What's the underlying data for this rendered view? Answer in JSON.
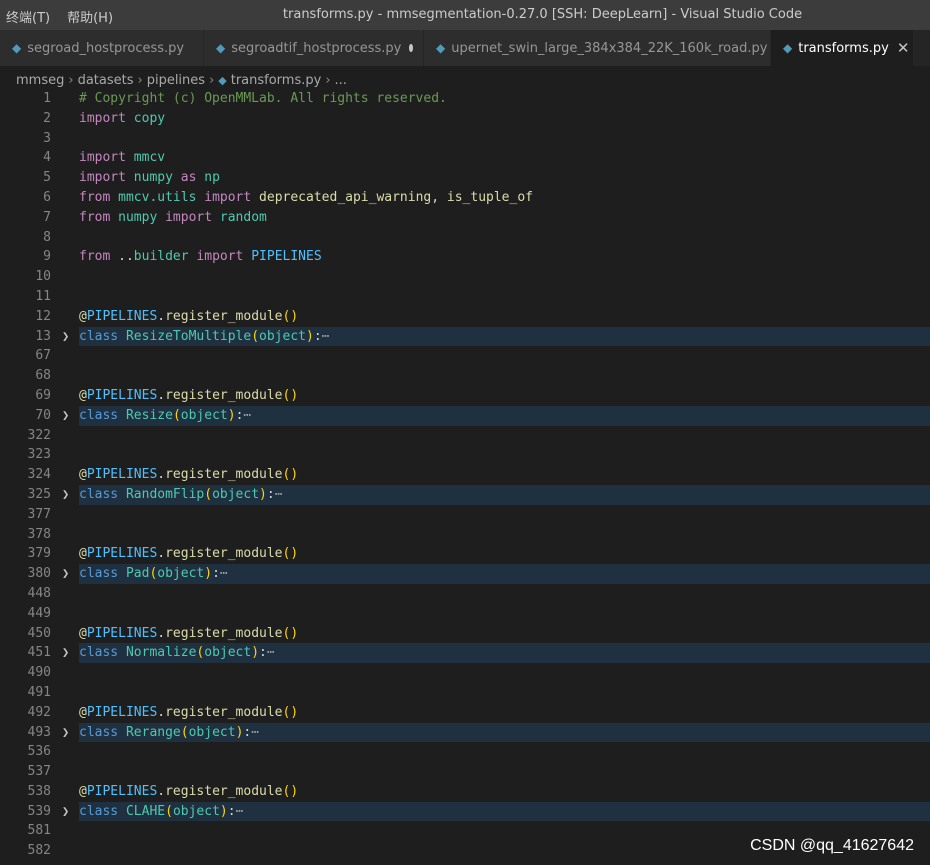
{
  "titlebar": {
    "menu": [
      "终端(T)",
      "帮助(H)"
    ],
    "title": "transforms.py - mmsegmentation-0.27.0 [SSH: DeepLearn] - Visual Studio Code"
  },
  "tabs": [
    {
      "label": "segroad_hostprocess.py",
      "state": "none"
    },
    {
      "label": "segroadtif_hostprocess.py",
      "state": "modified"
    },
    {
      "label": "upernet_swin_large_384x384_22K_160k_road.py",
      "state": "modified"
    },
    {
      "label": "transforms.py",
      "state": "close",
      "active": true
    }
  ],
  "breadcrumb": [
    "mmseg",
    "datasets",
    "pipelines",
    "transforms.py",
    "..."
  ],
  "lines": [
    {
      "n": "1",
      "tokens": [
        [
          "# Copyright (c) OpenMMLab. All rights reserved.",
          "comment"
        ]
      ]
    },
    {
      "n": "2",
      "tokens": [
        [
          "import",
          "kw"
        ],
        [
          " ",
          ""
        ],
        [
          "copy",
          "mod"
        ]
      ]
    },
    {
      "n": "3",
      "tokens": []
    },
    {
      "n": "4",
      "tokens": [
        [
          "import",
          "kw"
        ],
        [
          " ",
          ""
        ],
        [
          "mmcv",
          "mod"
        ]
      ]
    },
    {
      "n": "5",
      "tokens": [
        [
          "import",
          "kw"
        ],
        [
          " ",
          ""
        ],
        [
          "numpy",
          "mod"
        ],
        [
          " ",
          ""
        ],
        [
          "as",
          "kw"
        ],
        [
          " ",
          ""
        ],
        [
          "np",
          "mod"
        ]
      ]
    },
    {
      "n": "6",
      "tokens": [
        [
          "from",
          "kw"
        ],
        [
          " ",
          ""
        ],
        [
          "mmcv.utils",
          "mod"
        ],
        [
          " ",
          ""
        ],
        [
          "import",
          "kw"
        ],
        [
          " ",
          ""
        ],
        [
          "deprecated_api_warning",
          "fn"
        ],
        [
          ", ",
          "punc"
        ],
        [
          "is_tuple_of",
          "fn"
        ]
      ]
    },
    {
      "n": "7",
      "tokens": [
        [
          "from",
          "kw"
        ],
        [
          " ",
          ""
        ],
        [
          "numpy",
          "mod"
        ],
        [
          " ",
          ""
        ],
        [
          "import",
          "kw"
        ],
        [
          " ",
          ""
        ],
        [
          "random",
          "mod"
        ]
      ]
    },
    {
      "n": "8",
      "tokens": []
    },
    {
      "n": "9",
      "tokens": [
        [
          "from",
          "kw"
        ],
        [
          " ..",
          "punc"
        ],
        [
          "builder",
          "mod"
        ],
        [
          " ",
          ""
        ],
        [
          "import",
          "kw"
        ],
        [
          " ",
          ""
        ],
        [
          "PIPELINES",
          "const"
        ]
      ]
    },
    {
      "n": "10",
      "tokens": []
    },
    {
      "n": "11",
      "tokens": []
    },
    {
      "n": "12",
      "tokens": [
        [
          "@",
          "fn"
        ],
        [
          "PIPELINES",
          "const"
        ],
        [
          ".",
          "punc"
        ],
        [
          "register_module",
          "fn"
        ],
        [
          "()",
          "paren"
        ]
      ]
    },
    {
      "n": "13",
      "folded": true,
      "tokens": [
        [
          "class",
          "kwb"
        ],
        [
          " ",
          ""
        ],
        [
          "ResizeToMultiple",
          "cls"
        ],
        [
          "(",
          "paren"
        ],
        [
          "object",
          "cls"
        ],
        [
          ")",
          "paren"
        ],
        [
          ":",
          "punc"
        ],
        [
          "⋯",
          "ell"
        ]
      ]
    },
    {
      "n": "67",
      "tokens": []
    },
    {
      "n": "68",
      "tokens": []
    },
    {
      "n": "69",
      "tokens": [
        [
          "@",
          "fn"
        ],
        [
          "PIPELINES",
          "const"
        ],
        [
          ".",
          "punc"
        ],
        [
          "register_module",
          "fn"
        ],
        [
          "()",
          "paren"
        ]
      ]
    },
    {
      "n": "70",
      "folded": true,
      "tokens": [
        [
          "class",
          "kwb"
        ],
        [
          " ",
          ""
        ],
        [
          "Resize",
          "cls"
        ],
        [
          "(",
          "paren"
        ],
        [
          "object",
          "cls"
        ],
        [
          ")",
          "paren"
        ],
        [
          ":",
          "punc"
        ],
        [
          "⋯",
          "ell"
        ]
      ]
    },
    {
      "n": "322",
      "tokens": []
    },
    {
      "n": "323",
      "tokens": []
    },
    {
      "n": "324",
      "tokens": [
        [
          "@",
          "fn"
        ],
        [
          "PIPELINES",
          "const"
        ],
        [
          ".",
          "punc"
        ],
        [
          "register_module",
          "fn"
        ],
        [
          "()",
          "paren"
        ]
      ]
    },
    {
      "n": "325",
      "folded": true,
      "tokens": [
        [
          "class",
          "kwb"
        ],
        [
          " ",
          ""
        ],
        [
          "RandomFlip",
          "cls"
        ],
        [
          "(",
          "paren"
        ],
        [
          "object",
          "cls"
        ],
        [
          ")",
          "paren"
        ],
        [
          ":",
          "punc"
        ],
        [
          "⋯",
          "ell"
        ]
      ]
    },
    {
      "n": "377",
      "tokens": []
    },
    {
      "n": "378",
      "tokens": []
    },
    {
      "n": "379",
      "tokens": [
        [
          "@",
          "fn"
        ],
        [
          "PIPELINES",
          "const"
        ],
        [
          ".",
          "punc"
        ],
        [
          "register_module",
          "fn"
        ],
        [
          "()",
          "paren"
        ]
      ]
    },
    {
      "n": "380",
      "folded": true,
      "tokens": [
        [
          "class",
          "kwb"
        ],
        [
          " ",
          ""
        ],
        [
          "Pad",
          "cls"
        ],
        [
          "(",
          "paren"
        ],
        [
          "object",
          "cls"
        ],
        [
          ")",
          "paren"
        ],
        [
          ":",
          "punc"
        ],
        [
          "⋯",
          "ell"
        ]
      ]
    },
    {
      "n": "448",
      "tokens": []
    },
    {
      "n": "449",
      "tokens": []
    },
    {
      "n": "450",
      "tokens": [
        [
          "@",
          "fn"
        ],
        [
          "PIPELINES",
          "const"
        ],
        [
          ".",
          "punc"
        ],
        [
          "register_module",
          "fn"
        ],
        [
          "()",
          "paren"
        ]
      ]
    },
    {
      "n": "451",
      "folded": true,
      "tokens": [
        [
          "class",
          "kwb"
        ],
        [
          " ",
          ""
        ],
        [
          "Normalize",
          "cls"
        ],
        [
          "(",
          "paren"
        ],
        [
          "object",
          "cls"
        ],
        [
          ")",
          "paren"
        ],
        [
          ":",
          "punc"
        ],
        [
          "⋯",
          "ell"
        ]
      ]
    },
    {
      "n": "490",
      "tokens": []
    },
    {
      "n": "491",
      "tokens": []
    },
    {
      "n": "492",
      "tokens": [
        [
          "@",
          "fn"
        ],
        [
          "PIPELINES",
          "const"
        ],
        [
          ".",
          "punc"
        ],
        [
          "register_module",
          "fn"
        ],
        [
          "()",
          "paren"
        ]
      ]
    },
    {
      "n": "493",
      "folded": true,
      "tokens": [
        [
          "class",
          "kwb"
        ],
        [
          " ",
          ""
        ],
        [
          "Rerange",
          "cls"
        ],
        [
          "(",
          "paren"
        ],
        [
          "object",
          "cls"
        ],
        [
          ")",
          "paren"
        ],
        [
          ":",
          "punc"
        ],
        [
          "⋯",
          "ell"
        ]
      ]
    },
    {
      "n": "536",
      "tokens": []
    },
    {
      "n": "537",
      "tokens": []
    },
    {
      "n": "538",
      "tokens": [
        [
          "@",
          "fn"
        ],
        [
          "PIPELINES",
          "const"
        ],
        [
          ".",
          "punc"
        ],
        [
          "register_module",
          "fn"
        ],
        [
          "()",
          "paren"
        ]
      ]
    },
    {
      "n": "539",
      "folded": true,
      "tokens": [
        [
          "class",
          "kwb"
        ],
        [
          " ",
          ""
        ],
        [
          "CLAHE",
          "cls"
        ],
        [
          "(",
          "paren"
        ],
        [
          "object",
          "cls"
        ],
        [
          ")",
          "paren"
        ],
        [
          ":",
          "punc"
        ],
        [
          "⋯",
          "ell"
        ]
      ]
    },
    {
      "n": "581",
      "tokens": []
    },
    {
      "n": "582",
      "tokens": []
    }
  ],
  "watermark": "CSDN @qq_41627642",
  "colors": {
    "comment": "#6a9955",
    "keyword": "#c586c0",
    "class_keyword": "#569cd6",
    "module": "#4ec9b0",
    "function": "#dcdcaa",
    "constant": "#4fc1ff",
    "folded_line_bg": "#1f3040"
  }
}
